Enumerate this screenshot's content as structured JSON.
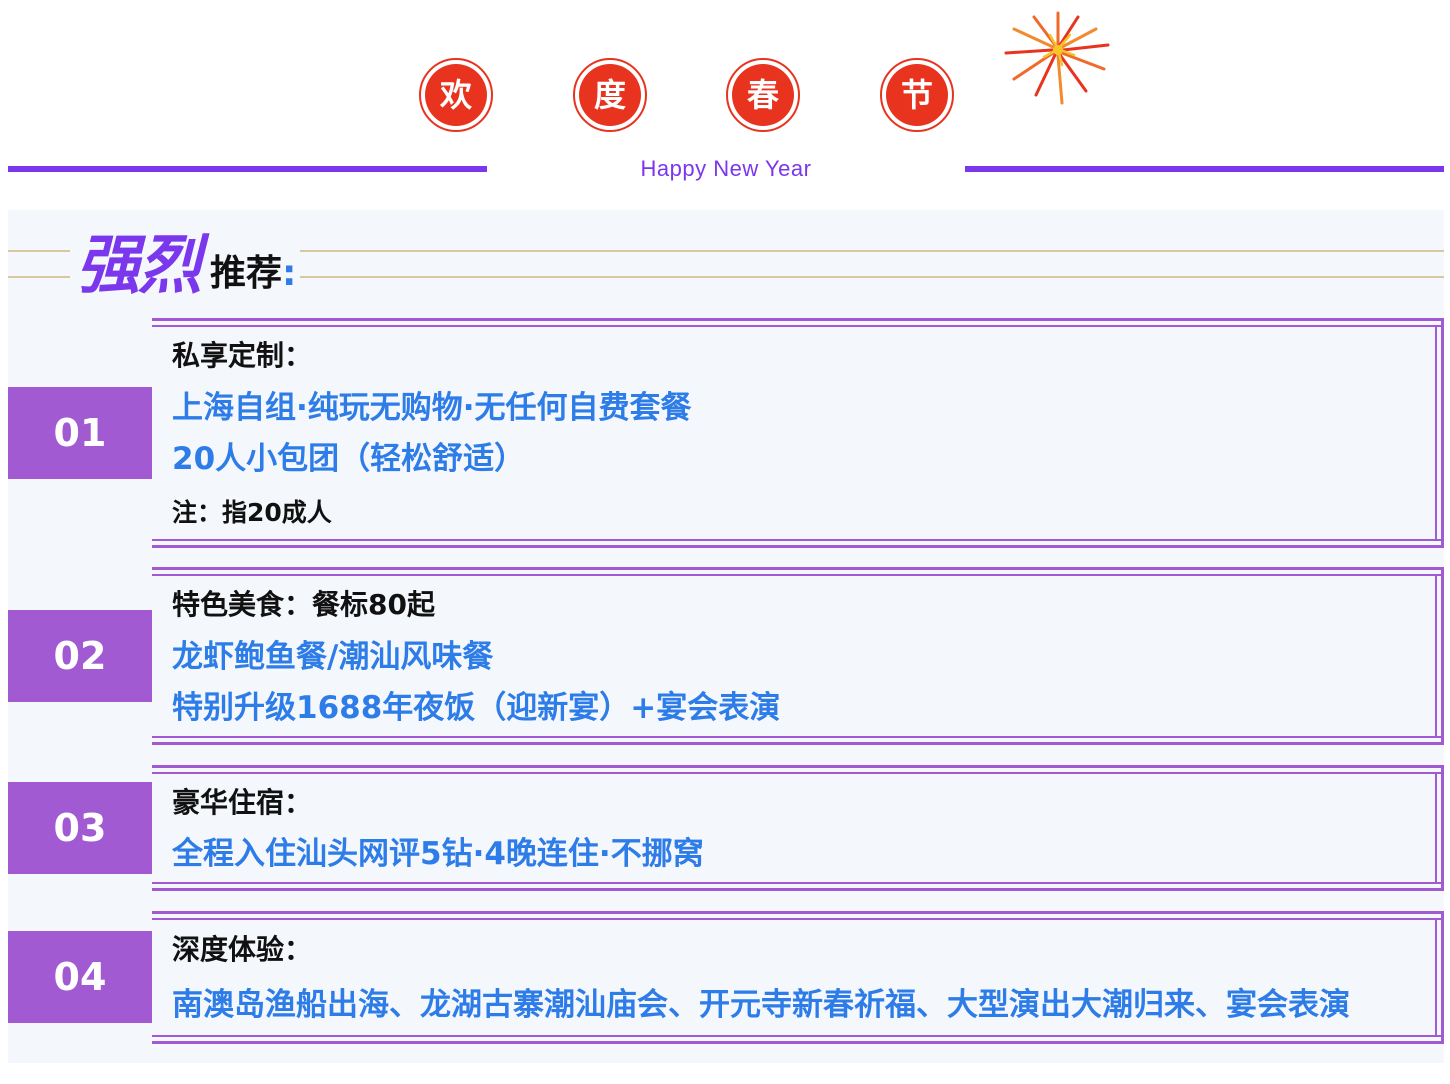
{
  "header": {
    "chars": [
      "欢",
      "度",
      "春",
      "节"
    ],
    "subtitle": "Happy New Year"
  },
  "recommend": {
    "big": "强烈",
    "small": "推荐",
    "colon": ":"
  },
  "sections": [
    {
      "number": "01",
      "title": "私享定制：",
      "lines": [
        "上海自组·纯玩无购物·无任何自费套餐",
        "20人小包团（轻松舒适）"
      ],
      "note": "注：指20成人"
    },
    {
      "number": "02",
      "title": "特色美食：餐标80起",
      "lines": [
        "龙虾鲍鱼餐/潮汕风味餐",
        "特别升级1688年夜饭（迎新宴）+宴会表演"
      ]
    },
    {
      "number": "03",
      "title": "豪华住宿：",
      "lines": [
        "全程入住汕头网评5钻·4晚连住·不挪窝"
      ]
    },
    {
      "number": "04",
      "title": "深度体验：",
      "lines": [
        "南澳岛渔船出海、龙湖古寨潮汕庙会、开元寺新春祈福、大型演出大潮归来、宴会表演"
      ]
    }
  ],
  "colors": {
    "red": "#e8331f",
    "purple": "#7a37ec",
    "violet": "#a15ad2",
    "blue": "#2d7ce8",
    "gold": "#d9c79e"
  }
}
